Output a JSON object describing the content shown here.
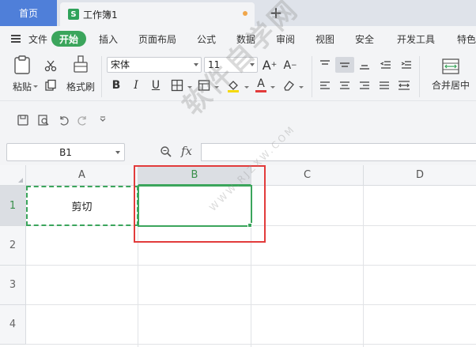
{
  "tabs": {
    "home": "首页",
    "workbook": "工作簿1",
    "workbook_icon": "S",
    "new_tab": "+"
  },
  "menu": {
    "file": "文件",
    "items": [
      "开始",
      "插入",
      "页面布局",
      "公式",
      "数据",
      "审阅",
      "视图",
      "安全",
      "开发工具",
      "特色"
    ]
  },
  "ribbon": {
    "paste": "粘贴",
    "format_painter": "格式刷",
    "font_name": "宋体",
    "font_size": "11",
    "bold": "B",
    "italic": "I",
    "underline": "U",
    "font_color_glyph": "A",
    "grow_font": "A",
    "shrink_font": "A",
    "merge_center": "合并居中"
  },
  "formula_bar": {
    "name_box": "B1",
    "fx": "fx",
    "formula": ""
  },
  "sheet": {
    "columns": [
      "A",
      "B",
      "C",
      "D"
    ],
    "rows": [
      "1",
      "2",
      "3",
      "4"
    ],
    "cells": {
      "A1": "剪切"
    }
  },
  "watermark": {
    "main": "软件自学网",
    "sub": "WWW.RJZXW.COM"
  },
  "colors": {
    "accent": "#3ba55c",
    "tab_blue": "#4f7fd9",
    "highlight_red": "#e23b3b"
  }
}
